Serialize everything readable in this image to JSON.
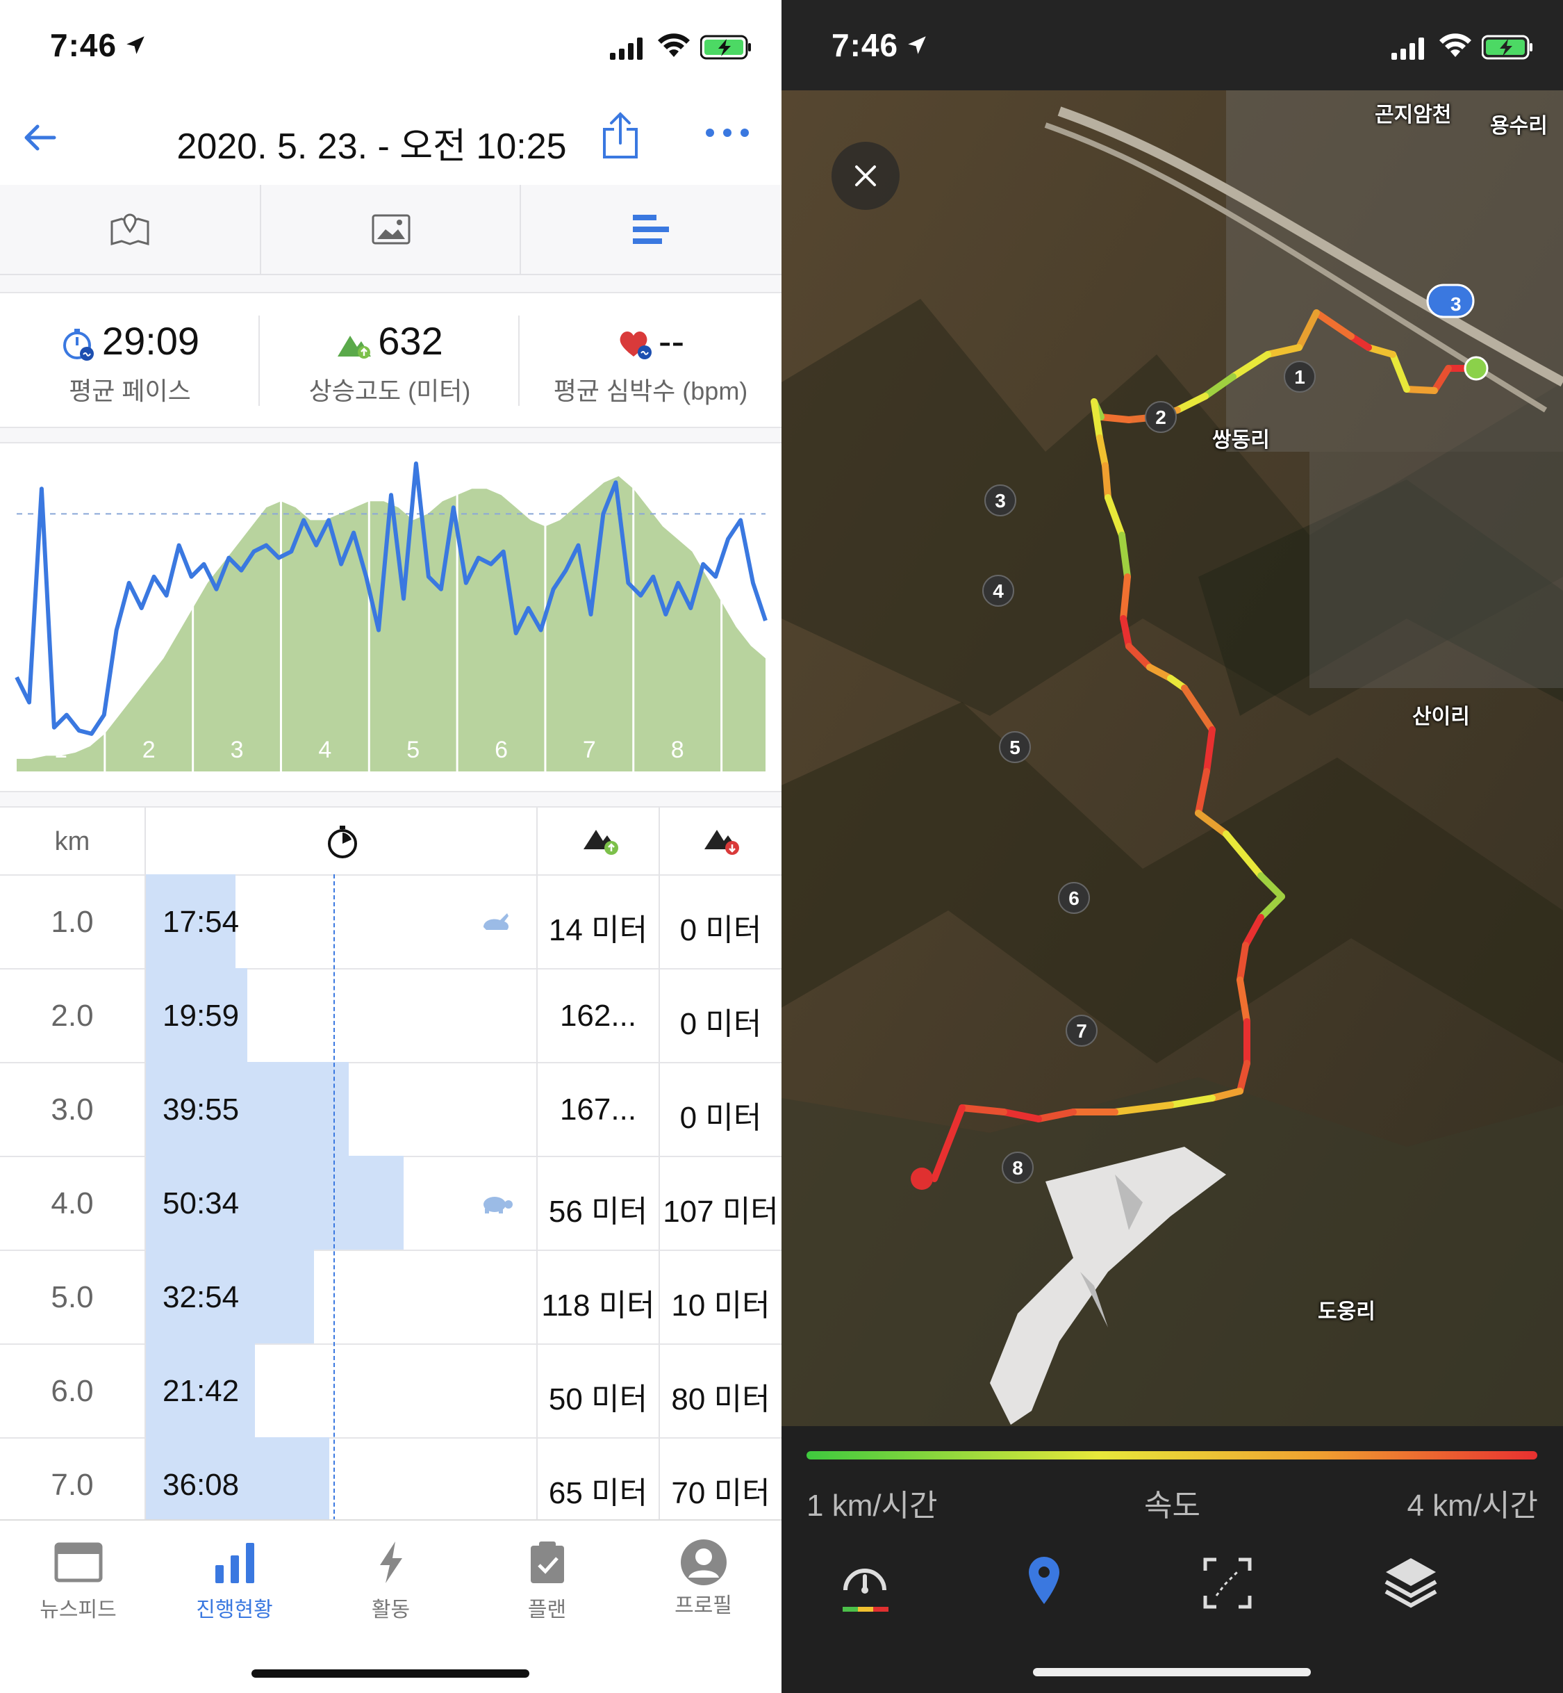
{
  "status_bar": {
    "time": "7:46"
  },
  "header": {
    "title": "2020. 5. 23. - 오전 10:25"
  },
  "view_tabs": [
    {
      "icon": "map-icon"
    },
    {
      "icon": "photo-icon"
    },
    {
      "icon": "splits-icon",
      "active": true
    }
  ],
  "stats": {
    "avg_pace": {
      "value": "29:09",
      "label": "평균 페이스"
    },
    "elevation_gain": {
      "value": "632",
      "label": "상승고도 (미터)"
    },
    "avg_heart_rate": {
      "value": "--",
      "label": "평균 심박수 (bpm)"
    }
  },
  "chart_data": {
    "type": "area",
    "categories": [
      "1",
      "2",
      "3",
      "4",
      "5",
      "6",
      "7",
      "8"
    ],
    "series": [
      {
        "kind": "area",
        "color": "#b8d39e",
        "values": [
          0.04,
          0.04,
          0.05,
          0.05,
          0.06,
          0.08,
          0.12,
          0.18,
          0.24,
          0.3,
          0.36,
          0.44,
          0.52,
          0.6,
          0.66,
          0.72,
          0.78,
          0.84,
          0.86,
          0.84,
          0.8,
          0.8,
          0.82,
          0.84,
          0.86,
          0.86,
          0.84,
          0.8,
          0.82,
          0.86,
          0.88,
          0.9,
          0.9,
          0.88,
          0.84,
          0.8,
          0.78,
          0.8,
          0.84,
          0.88,
          0.92,
          0.94,
          0.9,
          0.84,
          0.78,
          0.74,
          0.7,
          0.62,
          0.54,
          0.46,
          0.4,
          0.36
        ]
      },
      {
        "kind": "line",
        "color": "#3a78e0",
        "values": [
          0.3,
          0.22,
          0.9,
          0.14,
          0.18,
          0.13,
          0.12,
          0.18,
          0.45,
          0.6,
          0.52,
          0.62,
          0.56,
          0.72,
          0.62,
          0.66,
          0.58,
          0.68,
          0.64,
          0.7,
          0.72,
          0.68,
          0.7,
          0.8,
          0.72,
          0.8,
          0.66,
          0.76,
          0.62,
          0.45,
          0.88,
          0.55,
          0.98,
          0.62,
          0.58,
          0.84,
          0.6,
          0.68,
          0.66,
          0.7,
          0.44,
          0.52,
          0.45,
          0.58,
          0.64,
          0.72,
          0.5,
          0.82,
          0.92,
          0.6,
          0.56,
          0.62,
          0.5,
          0.6,
          0.52,
          0.66,
          0.62,
          0.74,
          0.8,
          0.6,
          0.48
        ]
      }
    ],
    "avg_line": 0.82,
    "grid": true
  },
  "splits": {
    "header_km": "km",
    "rows": [
      {
        "km": "1.0",
        "pace": "17:54",
        "up": "14 미터",
        "down": "0 미터",
        "bar": 0.23,
        "icon": "rabbit"
      },
      {
        "km": "2.0",
        "pace": "19:59",
        "up": "162...",
        "down": "0 미터",
        "bar": 0.26
      },
      {
        "km": "3.0",
        "pace": "39:55",
        "up": "167...",
        "down": "0 미터",
        "bar": 0.52
      },
      {
        "km": "4.0",
        "pace": "50:34",
        "up": "56 미터",
        "down": "107 미터",
        "bar": 0.66,
        "icon": "turtle"
      },
      {
        "km": "5.0",
        "pace": "32:54",
        "up": "118 미터",
        "down": "10 미터",
        "bar": 0.43
      },
      {
        "km": "6.0",
        "pace": "21:42",
        "up": "50 미터",
        "down": "80 미터",
        "bar": 0.28
      },
      {
        "km": "7.0",
        "pace": "36:08",
        "up": "65 미터",
        "down": "70 미터",
        "bar": 0.47
      }
    ]
  },
  "tabbar": [
    {
      "label": "뉴스피드",
      "icon": "newsfeed-icon"
    },
    {
      "label": "진행현황",
      "icon": "progress-icon",
      "active": true
    },
    {
      "label": "활동",
      "icon": "activity-icon"
    },
    {
      "label": "플랜",
      "icon": "plan-icon"
    },
    {
      "label": "프로필",
      "icon": "profile-icon"
    }
  ],
  "map": {
    "places": [
      "곤지암천",
      "용수리",
      "쌍동리",
      "산이리",
      "도웅리"
    ],
    "km_markers": [
      "1",
      "2",
      "3",
      "4",
      "5",
      "6",
      "7",
      "8"
    ],
    "badge": "3",
    "legend": {
      "min": "1 km/시간",
      "label": "속도",
      "max": "4 km/시간"
    }
  },
  "colors": {
    "accent": "#3a78e0",
    "bar": "#cfe0f8",
    "elevation": "#b8d39e"
  }
}
